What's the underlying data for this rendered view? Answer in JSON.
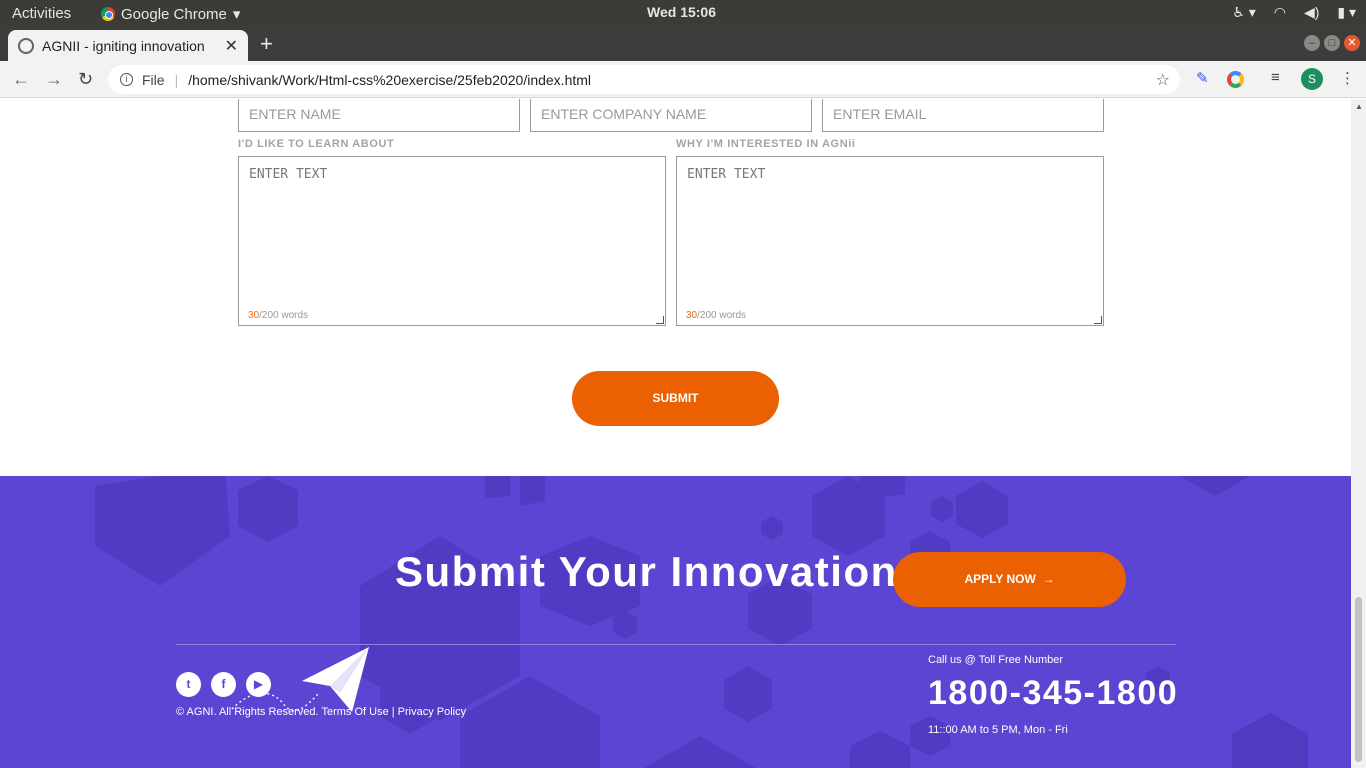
{
  "system": {
    "activities": "Activities",
    "app_name": "Google Chrome",
    "clock": "Wed 15:06"
  },
  "browser": {
    "tab_title": "AGNII - igniting innovation",
    "url_scheme": "File",
    "url": "/home/shivank/Work/Html-css%20exercise/25feb2020/index.html",
    "avatar_letter": "S"
  },
  "form": {
    "name_placeholder": "ENTER NAME",
    "company_placeholder": "ENTER COMPANY NAME",
    "email_placeholder": "ENTER EMAIL",
    "learn_label": "I'D LIKE TO LEARN ABOUT",
    "interest_label": "WHY I'M INTERESTED IN AGNii",
    "learn_placeholder": "ENTER TEXT",
    "interest_placeholder": "ENTER TEXT",
    "word_count_current": "30",
    "word_count_suffix": "/200 words",
    "submit_label": "SUBMIT"
  },
  "footer": {
    "headline": "Submit Your Innovation",
    "apply_label": "APPLY NOW",
    "social_icons": [
      "twitter-icon",
      "facebook-icon",
      "youtube-icon"
    ],
    "copyright": "© AGNI. All Rights Reserved. Terms Of Use | Privacy Policy",
    "call_text": "Call us @ Toll Free Number",
    "phone": "1800-345-1800",
    "hours": "11::00 AM to 5 PM, Mon - Fri"
  },
  "colors": {
    "accent_orange": "#eb6000",
    "footer_purple": "#5c45d2"
  }
}
